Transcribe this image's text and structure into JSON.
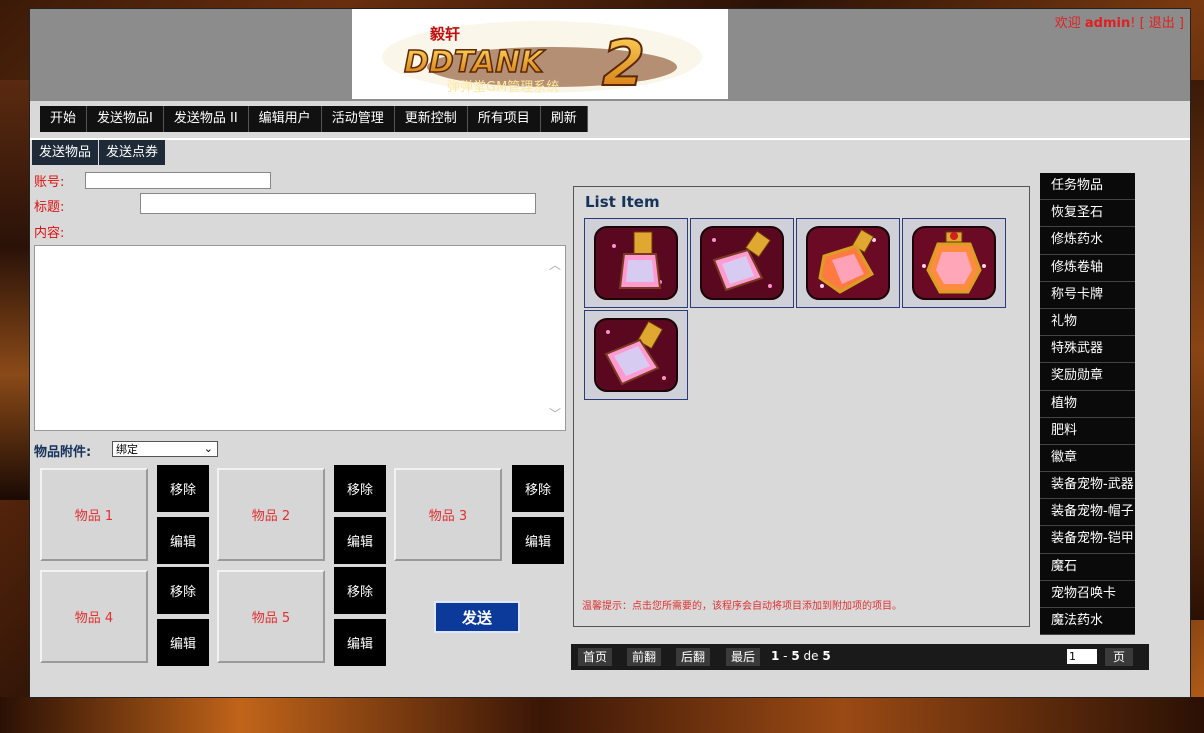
{
  "header": {
    "logo_top": "毅轩",
    "logo_main": "DDTANK",
    "logo_num": "2",
    "logo_sub": "弹弹堂GM管理系统",
    "welcome_prefix": "欢迎 ",
    "username": "admin",
    "welcome_suffix": "! [ 退出 ]"
  },
  "topnav": [
    "开始",
    "发送物品I",
    "发送物品 II",
    "编辑用户",
    "活动管理",
    "更新控制",
    "所有项目",
    "刷新"
  ],
  "subnav": [
    "发送物品",
    "发送点券"
  ],
  "form": {
    "account_label": "账号:",
    "account_value": "",
    "title_label": "标题:",
    "title_value": "",
    "content_label": "内容:",
    "content_value": "",
    "attach_label": "物品附件:",
    "attach_selected": "绑定"
  },
  "slots": [
    {
      "label": "物品 1",
      "remove": "移除",
      "edit": "编辑"
    },
    {
      "label": "物品 2",
      "remove": "移除",
      "edit": "编辑"
    },
    {
      "label": "物品 3",
      "remove": "移除",
      "edit": "编辑"
    },
    {
      "label": "物品 4",
      "remove": "移除",
      "edit": "编辑"
    },
    {
      "label": "物品 5",
      "remove": "移除",
      "edit": "编辑"
    }
  ],
  "send_label": "发送",
  "list": {
    "title": "List Item",
    "items": [
      "potion-item-1-icon",
      "potion-item-2-icon",
      "potion-item-3-icon",
      "potion-item-4-icon",
      "potion-item-5-icon"
    ],
    "tip": "温馨提示：点击您所需要的，该程序会自动将项目添加到附加项的项目。"
  },
  "pager": {
    "first": "首页",
    "prev": "前翻",
    "next": "后翻",
    "last": "最后",
    "range_start": "1",
    "range_sep": " - ",
    "range_end": "5",
    "of": " de ",
    "total": "5",
    "page_input": "1",
    "page_label": "页"
  },
  "categories": [
    "任务物品",
    "恢复圣石",
    "修炼药水",
    "修炼卷轴",
    "称号卡牌",
    "礼物",
    "特殊武器",
    "奖励勋章",
    "植物",
    "肥料",
    "徽章",
    "装备宠物-武器",
    "装备宠物-帽子",
    "装备宠物-铠甲",
    "魔石",
    "宠物召唤卡",
    "魔法药水"
  ],
  "colors": {
    "accent_red": "#e02020",
    "send_blue": "#0b3a9a",
    "title_navy": "#14325a"
  }
}
